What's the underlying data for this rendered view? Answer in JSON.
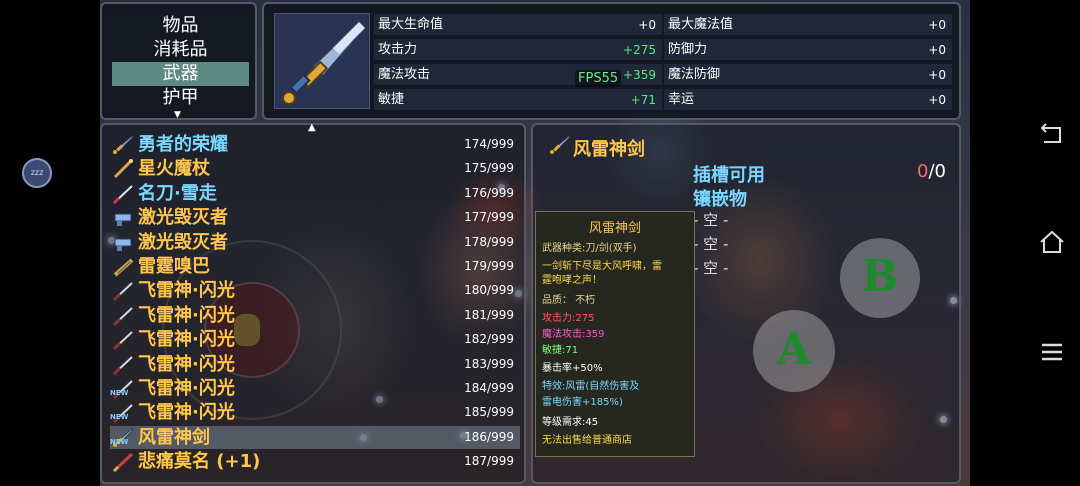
{
  "categories": {
    "items": [
      "物品",
      "消耗品",
      "武器",
      "护甲"
    ],
    "selected_index": 2
  },
  "stats": {
    "left": [
      {
        "label": "最大生命值",
        "value": "+0"
      },
      {
        "label": "攻击力",
        "value": "+275"
      },
      {
        "label": "魔法攻击",
        "value": "+359"
      },
      {
        "label": "敏捷",
        "value": "+71"
      }
    ],
    "right": [
      {
        "label": "最大魔法值",
        "value": "+0"
      },
      {
        "label": "防御力",
        "value": "+0"
      },
      {
        "label": "魔法防御",
        "value": "+0"
      },
      {
        "label": "幸运",
        "value": "+0"
      }
    ],
    "fps": "FPS55"
  },
  "items": [
    {
      "name": "勇者的荣耀",
      "count": "174/999",
      "color": "#7ad8ff",
      "icon": "sword-icon"
    },
    {
      "name": "星火魔杖",
      "count": "175/999",
      "color": "#ffc64a",
      "icon": "wand-icon"
    },
    {
      "name": "名刀·雪走",
      "count": "176/999",
      "color": "#7ad8ff",
      "icon": "katana-icon"
    },
    {
      "name": "激光毁灭者",
      "count": "177/999",
      "color": "#ffc64a",
      "icon": "laser-gun-icon"
    },
    {
      "name": "激光毁灭者",
      "count": "178/999",
      "color": "#ffc64a",
      "icon": "laser-gun-icon"
    },
    {
      "name": "雷霆嗅巴",
      "count": "179/999",
      "color": "#ffc64a",
      "icon": "gun-icon"
    },
    {
      "name": "飞雷神·闪光",
      "count": "180/999",
      "color": "#ffc64a",
      "icon": "kunai-icon"
    },
    {
      "name": "飞雷神·闪光",
      "count": "181/999",
      "color": "#ffc64a",
      "icon": "kunai-icon"
    },
    {
      "name": "飞雷神·闪光",
      "count": "182/999",
      "color": "#ffc64a",
      "icon": "kunai-icon"
    },
    {
      "name": "飞雷神·闪光",
      "count": "183/999",
      "color": "#ffc64a",
      "icon": "kunai-icon"
    },
    {
      "name": "飞雷神·闪光",
      "count": "184/999",
      "color": "#ffc64a",
      "icon": "kunai-icon",
      "new": "NEW"
    },
    {
      "name": "飞雷神·闪光",
      "count": "185/999",
      "color": "#ffc64a",
      "icon": "kunai-icon",
      "new": "NEW"
    },
    {
      "name": "风雷神剑",
      "count": "186/999",
      "color": "#ffc64a",
      "icon": "sword-icon",
      "new": "NEW",
      "selected": true
    },
    {
      "name": "悲痛莫名 (+1)",
      "count": "187/999",
      "color": "#ffc64a",
      "icon": "red-blade-icon"
    }
  ],
  "detail": {
    "title": "风雷神剑",
    "slot_label": "插槽可用",
    "inlay_label": "镶嵌物",
    "slot_used": "0",
    "slot_total": "/0",
    "empty_slots": [
      "- 空 -",
      "- 空 -",
      "- 空 -"
    ],
    "tooltip": {
      "title": "风雷神剑",
      "type": "武器种类:刀/剑(双手)",
      "desc1": "一剑斩下尽是大风呼啸，雷",
      "desc2": "霆咆哮之声！",
      "quality": "品质： 不朽",
      "atk": "攻击力:275",
      "matk": "魔法攻击:359",
      "agi": "敏捷:71",
      "crit": "暴击率+50%",
      "special1": "特效:风雷(自然伤害及",
      "special2": "雷电伤害+185%)",
      "level": "等级需求:45",
      "shop": "无法出售给普通商店"
    }
  },
  "controls": {
    "a": "A",
    "b": "B"
  },
  "sleep_badge": "zzz",
  "colors": {
    "panel_border": "#555b66",
    "highlight": "#5f8a82",
    "stat_green": "#4ef07a"
  }
}
